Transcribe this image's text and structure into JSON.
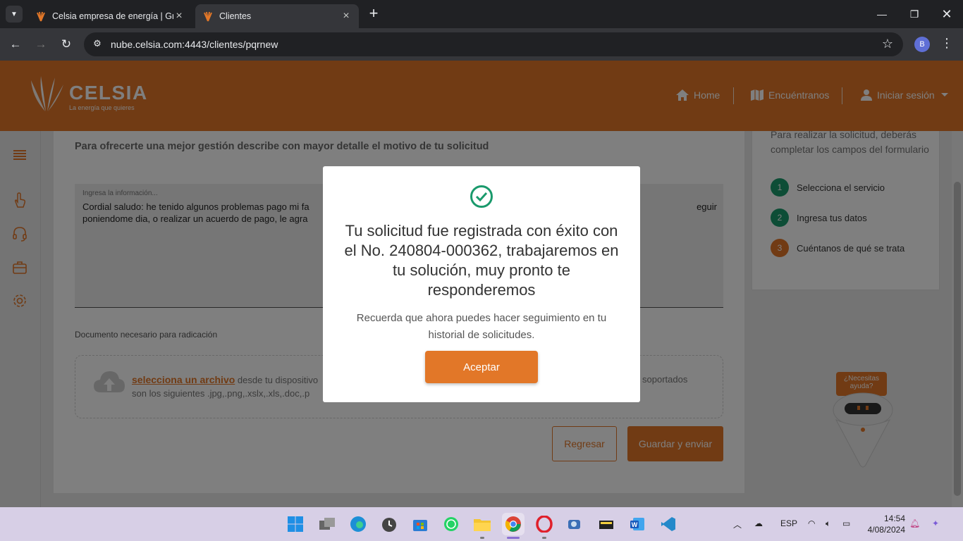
{
  "browser": {
    "tabs": [
      {
        "title": "Celsia empresa de energía | Gru",
        "active": false
      },
      {
        "title": "Clientes",
        "active": true
      }
    ],
    "url": "nube.celsia.com:4443/clientes/pqrnew",
    "profile_initial": "B"
  },
  "header": {
    "brand": "CELSIA",
    "tagline": "La energía que quieres",
    "nav": [
      {
        "label": "Home",
        "icon": "home-icon"
      },
      {
        "label": "Encuéntranos",
        "icon": "map-icon"
      },
      {
        "label": "Iniciar sesión",
        "icon": "user-icon"
      }
    ]
  },
  "form": {
    "subtitle": "Para ofrecerte una mejor gestión describe con mayor detalle el motivo de tu solicitud",
    "textarea_placeholder": "Ingresa la información...",
    "textarea_value": "Cordial saludo: he tenido algunos problemas pago mi fa                                                                                                          eguir poniendome dia, o realizar un acuerdo de pago, le agra",
    "textarea_line1_left": "Cordial saludo: he tenido algunos problemas pago mi fa",
    "textarea_line1_right": "eguir",
    "textarea_line2": "poniendome dia, o realizar un acuerdo de pago, le agra",
    "document_label": "Documento necesario para radicación",
    "upload_link": "selecciona un archivo",
    "upload_text": "desde tu dispositivo",
    "upload_formats": "son los siguientes .jpg,.png,.xslx,.xls,.doc,.p",
    "upload_right": "soportados",
    "back_button": "Regresar",
    "submit_button": "Guardar y enviar"
  },
  "steps": {
    "intro": "Para realizar la solicitud, deberás completar los campos del formulario",
    "items": [
      {
        "num": "1",
        "label": "Selecciona el servicio",
        "color": "#1a9a6c"
      },
      {
        "num": "2",
        "label": "Ingresa tus datos",
        "color": "#1a9a6c"
      },
      {
        "num": "3",
        "label": "Cuéntanos de qué se trata",
        "color": "#e27728"
      }
    ]
  },
  "chatbot": {
    "bubble": "¿Necesitas ayuda?"
  },
  "modal": {
    "heading": "Tu solicitud fue registrada con éxito con el No. 240804-000362, trabajaremos en tu solución, muy pronto te responderemos",
    "body": "Recuerda que ahora puedes hacer seguimiento en tu historial de solicitudes.",
    "accept_button": "Aceptar"
  },
  "taskbar": {
    "language": "ESP",
    "time": "14:54",
    "date": "4/08/2024"
  },
  "colors": {
    "accent": "#e27728",
    "success": "#1a9a6c"
  }
}
